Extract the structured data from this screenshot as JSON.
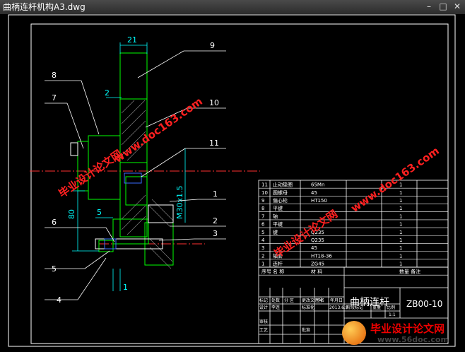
{
  "window": {
    "title": "曲柄连杆机构A3.dwg"
  },
  "drawing": {
    "dims": {
      "d21": "21",
      "d2": "2",
      "d80": "80",
      "d5": "5",
      "d1": "1",
      "thread": "M30x1.5"
    },
    "balloons": [
      "9",
      "10",
      "11",
      "1",
      "2",
      "3",
      "8",
      "7",
      "6",
      "5",
      "4"
    ],
    "watermarks": [
      "www.doc163.com",
      "毕业设计论文网"
    ]
  },
  "bom": {
    "rows": [
      {
        "no": "11",
        "name": "止动垫圈",
        "material": "65Mn",
        "qty": "1"
      },
      {
        "no": "10",
        "name": "圆螺母",
        "material": "45",
        "qty": "1"
      },
      {
        "no": "9",
        "name": "偏心轮",
        "material": "HT150",
        "qty": "1"
      },
      {
        "no": "8",
        "name": "平键",
        "material": "",
        "qty": "1"
      },
      {
        "no": "7",
        "name": "轴",
        "material": "",
        "qty": "1"
      },
      {
        "no": "6",
        "name": "平键",
        "material": "",
        "qty": "1"
      },
      {
        "no": "5",
        "name": "键",
        "material": "Q235",
        "qty": "1"
      },
      {
        "no": "4",
        "name": "",
        "material": "Q235",
        "qty": "1"
      },
      {
        "no": "3",
        "name": "",
        "material": "45",
        "qty": "1"
      },
      {
        "no": "2",
        "name": "轴套",
        "material": "HT18-36",
        "qty": "1"
      },
      {
        "no": "1",
        "name": "连杆",
        "material": "ZG45",
        "qty": "1"
      }
    ],
    "header": {
      "no": "序号",
      "name": "名 称",
      "material": "材 料",
      "qty": "数量 备注"
    }
  },
  "titleblock": {
    "name": "曲柄连杆",
    "code": "ZB00-10",
    "labels": {
      "mark": "标记",
      "count": "处数",
      "zone": "分 区",
      "doc": "更改文件号",
      "sign": "签名",
      "date": "年月日",
      "design": "设计",
      "std": "标准化",
      "stage": "阶段标记",
      "weight": "重量",
      "scale": "比例",
      "review": "审核",
      "craft": "工艺",
      "approve": "批准"
    },
    "designer": "李连",
    "year": "2013.6.9",
    "scale": "1:1"
  },
  "footer": {
    "brand": "毕业设计论文网",
    "url": "www.56doc.com"
  },
  "colors": {
    "green": "#00ff00",
    "white": "#ffffff",
    "cyan": "#00ffff",
    "red": "#ff3030",
    "blue": "#3a6cff",
    "yellow": "#ffff00",
    "watermark": "#ff2020"
  }
}
